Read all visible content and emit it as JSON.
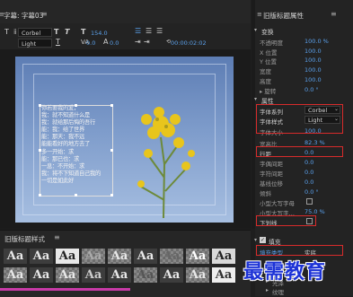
{
  "title_window": {
    "title": "字幕: 字幕03",
    "font_family": "Corbel",
    "font_style": "Light",
    "font_size": "154.0",
    "tracking": "0.0",
    "leading": "0.0",
    "timecode": "00:00:02:02"
  },
  "canvas": {
    "text_lines": [
      "你若要我的爱，",
      "我：就不知道什么是",
      "我：就给那后悔的吾行",
      "能：我：给了世界",
      "能：那天：我不远",
      "能能看好的地方去了",
      "多一开始：求",
      "能：那已也：求",
      "一息：不开始：求",
      "我：将不下知道自己我的",
      "一切是如此好"
    ]
  },
  "styles_panel": {
    "title": "旧版标题样式",
    "menu_icon": "menu-icon",
    "swatch_labels": [
      "Aa",
      "Aa",
      "Aa",
      "Aa",
      "Aa",
      "Aa",
      "Aa",
      "Aa",
      "Aa",
      "Aa",
      "Aa",
      "Aa",
      "Aa",
      "Aa",
      "Aa",
      "Aa",
      "Aa",
      "Aa"
    ]
  },
  "properties": {
    "panel_title": "旧版标题属性",
    "section_transform": "变换",
    "opacity_label": "不透明度",
    "opacity_value": "100.0 %",
    "x_label": "X 位置",
    "x_value": "100.0",
    "y_label": "Y 位置",
    "y_value": "100.0",
    "width_label": "宽度",
    "width_value": "100.0",
    "height_label": "高度",
    "height_value": "100.0",
    "rotation_label": "▸ 旋转",
    "rotation_value": "0.0 °",
    "section_props": "属性",
    "font_family_label": "字体系列",
    "font_family_value": "Corbel",
    "font_style_label": "字体样式",
    "font_style_value": "Light",
    "font_size_label": "字体大小",
    "font_size_value": "100.0",
    "aspect_label": "宽高比",
    "aspect_value": "82.3 %",
    "leading_label": "行距",
    "leading_value": "0.0",
    "kerning_label": "字偶间距",
    "kerning_value": "0.0",
    "tracking_label": "字符间距",
    "tracking_value": "0.0",
    "baseline_label": "基线位移",
    "baseline_value": "0.0",
    "slant_label": "倾斜",
    "slant_value": "0.0 °",
    "smallcaps_label": "小型大写字母",
    "smallcaps_size_label": "小型大写字…",
    "smallcaps_size_value": "75.0 %",
    "underline_label": "下划线",
    "fill_label": "填充",
    "fill_type_label": "填充类型",
    "fill_type_value": "实底",
    "gloss_label": "光泽",
    "texture_label": "纹理"
  },
  "watermark": "最需教育",
  "colors": {
    "accent": "#5aa0ec",
    "highlight": "#d82b2b",
    "watermark": "#1d33d6"
  }
}
